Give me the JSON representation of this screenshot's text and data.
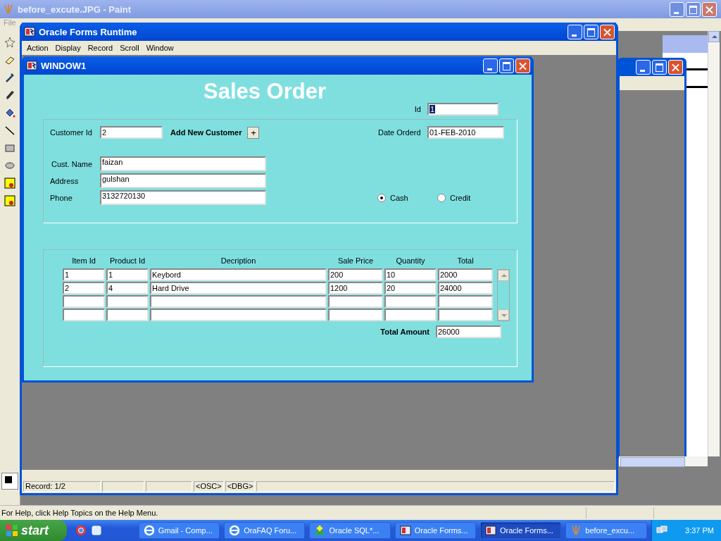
{
  "paint": {
    "title": "before_excute.JPG - Paint",
    "menu": [
      "File"
    ],
    "status": "For Help, click Help Topics on the Help Menu."
  },
  "forms": {
    "title": "Oracle Forms Runtime",
    "menu": [
      "Action",
      "Display",
      "Record",
      "Scroll",
      "Window"
    ],
    "status_bar": {
      "record": "Record: 1/2",
      "items": [
        "<OSC>",
        "<DBG>"
      ]
    }
  },
  "window1": {
    "title": "WINDOW1",
    "heading": "Sales Order",
    "id": {
      "label": "Id",
      "value": "1",
      "highlighted": true
    },
    "customer_id": {
      "label": "Customer Id",
      "value": "2"
    },
    "add_customer": {
      "label": "Add New Customer",
      "button": "+"
    },
    "date": {
      "label": "Date Orderd",
      "value": "01-FEB-2010"
    },
    "fields": [
      {
        "label": "Cust. Name",
        "value": "faizan"
      },
      {
        "label": "Address",
        "value": "gulshan"
      },
      {
        "label": "Phone",
        "value": "3132720130"
      }
    ],
    "payment": [
      {
        "label": "Cash",
        "selected": true
      },
      {
        "label": "Credit",
        "selected": false
      }
    ],
    "table": {
      "columns": [
        "Item Id",
        "Product Id",
        "Decription",
        "Sale Price",
        "Quantity",
        "Total"
      ],
      "rows": [
        [
          "1",
          "1",
          "Keybord",
          "200",
          "10",
          "2000"
        ],
        [
          "2",
          "4",
          "Hard Drive",
          "1200",
          "20",
          "24000"
        ]
      ]
    },
    "total": {
      "label": "Total Amount",
      "value": "26000"
    }
  },
  "taskbar": {
    "start": "start",
    "buttons": [
      {
        "label": "Gmail - Comp...",
        "kind": "browser",
        "selected": false
      },
      {
        "label": "OraFAQ Foru...",
        "kind": "browser",
        "selected": false
      },
      {
        "label": "Oracle SQL*...",
        "kind": "sql",
        "selected": false
      },
      {
        "label": "Oracle Forms...",
        "kind": "forms",
        "selected": false
      },
      {
        "label": "Oracle Forms...",
        "kind": "forms",
        "selected": true
      },
      {
        "label": "before_excu...",
        "kind": "paint",
        "selected": false
      }
    ],
    "clock": "3:37 PM"
  }
}
